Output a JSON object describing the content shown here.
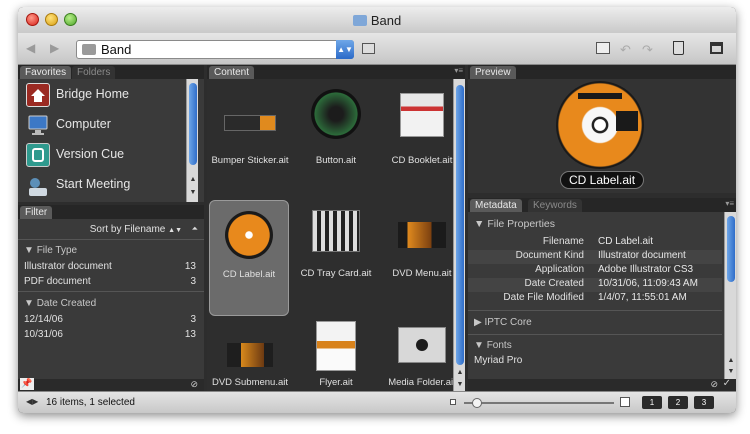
{
  "window": {
    "title": "Band"
  },
  "toolbar": {
    "path": "Band",
    "back_icon": "back-arrow-icon",
    "forward_icon": "forward-arrow-icon"
  },
  "left_tabs": {
    "favorites": "Favorites",
    "folders": "Folders"
  },
  "favorites": [
    {
      "label": "Bridge Home",
      "icon": "bridge-home-icon",
      "color": "#9b2a22"
    },
    {
      "label": "Computer",
      "icon": "computer-icon",
      "color": "#3c78c6"
    },
    {
      "label": "Version Cue",
      "icon": "version-cue-icon",
      "color": "#2f9a8e"
    },
    {
      "label": "Start Meeting",
      "icon": "start-meeting-icon",
      "color": "#5c8fb8"
    }
  ],
  "filter": {
    "tab": "Filter",
    "sort_label": "Sort by Filename",
    "file_type_header": "File Type",
    "file_types": [
      {
        "label": "Illustrator document",
        "count": "13"
      },
      {
        "label": "PDF document",
        "count": "3"
      }
    ],
    "date_created_header": "Date Created",
    "dates": [
      {
        "label": "12/14/06",
        "count": "3"
      },
      {
        "label": "10/31/06",
        "count": "13"
      }
    ]
  },
  "content": {
    "tab": "Content",
    "items": [
      {
        "name": "Bumper Sticker.ait",
        "selected": false
      },
      {
        "name": "Button.ait",
        "selected": false
      },
      {
        "name": "CD Booklet.ait",
        "selected": false
      },
      {
        "name": "CD Label.ait",
        "selected": true
      },
      {
        "name": "CD Tray Card.ait",
        "selected": false
      },
      {
        "name": "DVD Menu.ait",
        "selected": false
      },
      {
        "name": "DVD Submenu.ait",
        "selected": false
      },
      {
        "name": "Flyer.ait",
        "selected": false
      },
      {
        "name": "Media Folder.ait",
        "selected": false
      }
    ]
  },
  "preview": {
    "tab": "Preview",
    "caption": "CD Label.ait"
  },
  "metadata": {
    "tab": "Metadata",
    "keywords_tab": "Keywords",
    "file_properties_header": "File Properties",
    "rows": [
      {
        "key": "Filename",
        "value": "CD Label.ait"
      },
      {
        "key": "Document Kind",
        "value": "Illustrator document"
      },
      {
        "key": "Application",
        "value": "Adobe Illustrator CS3"
      },
      {
        "key": "Date Created",
        "value": "10/31/06, 11:09:43 AM"
      },
      {
        "key": "Date File Modified",
        "value": "1/4/07, 11:55:01 AM"
      }
    ],
    "iptc_header": "IPTC Core",
    "fonts_header": "Fonts",
    "font_name": "Myriad Pro"
  },
  "status": {
    "text": "16 items, 1 selected",
    "view_buttons": [
      "1",
      "2",
      "3"
    ]
  }
}
